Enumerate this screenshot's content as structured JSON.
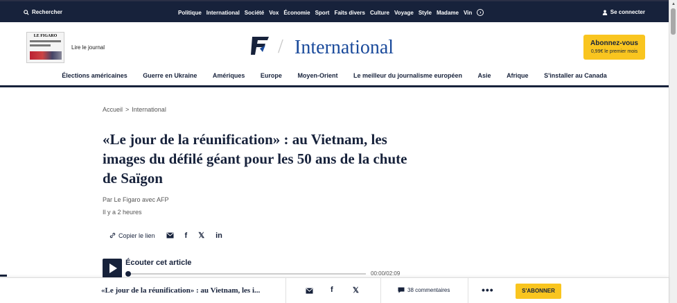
{
  "topbar": {
    "search_label": "Rechercher",
    "nav": [
      "Politique",
      "International",
      "Société",
      "Vox",
      "Économie",
      "Sport",
      "Faits divers",
      "Culture",
      "Voyage",
      "Style",
      "Madame",
      "Vin"
    ],
    "login_label": "Se connecter"
  },
  "header": {
    "newspaper_title": "LE FIGARO",
    "read_journal": "Lire le journal",
    "section_title": "International",
    "subscribe_main": "Abonnez-vous",
    "subscribe_sub": "0,99€ le premier mois"
  },
  "subnav": [
    "Élections américaines",
    "Guerre en Ukraine",
    "Amériques",
    "Europe",
    "Moyen-Orient",
    "Le meilleur du journalisme européen",
    "Asie",
    "Afrique",
    "S'installer au Canada"
  ],
  "article": {
    "breadcrumb_home": "Accueil",
    "breadcrumb_sep": ">",
    "breadcrumb_section": "International",
    "headline": "«Le jour de la réunification» : au Vietnam, les images du défilé géant pour les 50 ans de la chute de Saïgon",
    "byline": "Par Le Figaro avec AFP",
    "time": "Il y a 2 heures",
    "copy_link": "Copier le lien",
    "audio_label": "Écouter cet article",
    "audio_time": "00:00/02:09"
  },
  "sticky": {
    "title": "«Le jour de la réunification» : au Vietnam, les i...",
    "comments": "38 commentaires",
    "subscribe": "S'ABONNER"
  },
  "colors": {
    "navy": "#17223b",
    "accent_blue": "#1a4a9b",
    "subscribe_yellow": "#f9c51f"
  }
}
